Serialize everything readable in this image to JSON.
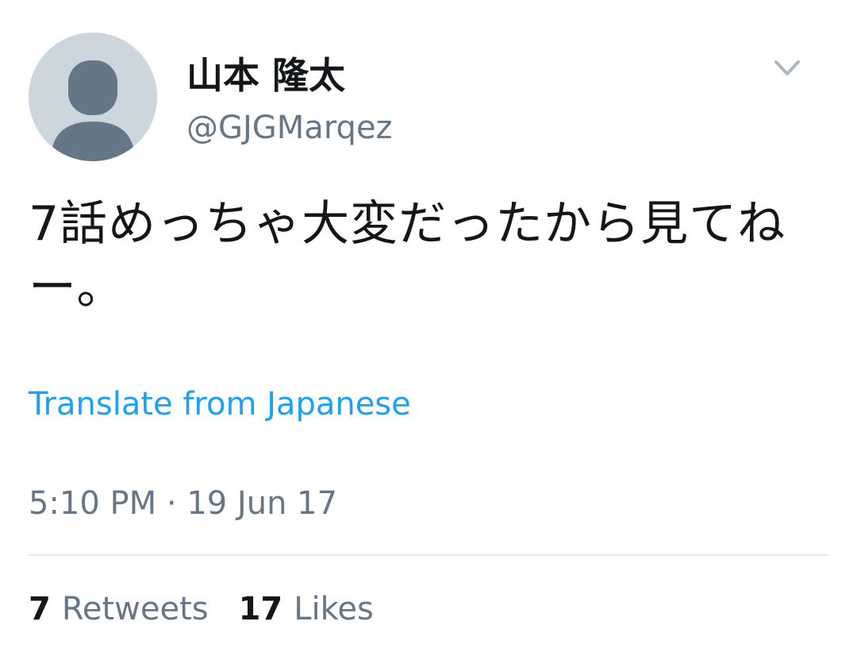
{
  "user": {
    "display_name": "山本 隆太",
    "handle": "@GJGMarqez",
    "avatar_icon": "default-profile-silhouette-icon"
  },
  "menu": {
    "icon": "chevron-down-icon"
  },
  "tweet": {
    "text": "7話めっちゃ大変だったから見てねー。",
    "translate_label": "Translate from Japanese",
    "timestamp": "5:10 PM · 19 Jun 17"
  },
  "stats": {
    "retweets_count": "7",
    "retweets_label": "Retweets",
    "likes_count": "17",
    "likes_label": "Likes"
  },
  "colors": {
    "link": "#1da1f2",
    "secondary_text": "#657786",
    "primary_text": "#14171a",
    "divider": "#e1e8ed",
    "avatar_bg": "#ccd6dd",
    "avatar_fg": "#657786"
  }
}
